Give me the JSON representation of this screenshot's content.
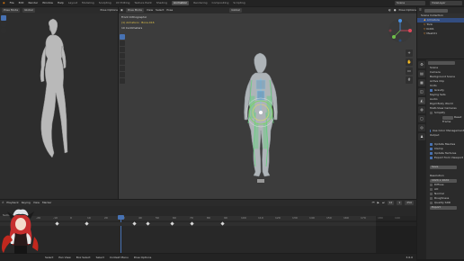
{
  "menu": {
    "items": [
      "File",
      "Edit",
      "Render",
      "Window",
      "Help"
    ],
    "workspaces": [
      "Layout",
      "Modeling",
      "Sculpting",
      "UV Editing",
      "Texture Paint",
      "Shading",
      "Animation",
      "Rendering",
      "Compositing",
      "Scripting"
    ],
    "active_workspace": "Animation",
    "scene": "Scene",
    "view_layer": "ViewLayer"
  },
  "left_view": {
    "mode": "Pose Mode",
    "orientation": "Global",
    "title": "Pose Options"
  },
  "main_view": {
    "mode": "Pose Mode",
    "menus": [
      "View",
      "Select",
      "Pose"
    ],
    "orientation": "Global",
    "options": "Pose Options",
    "ortho_label": "Front Orthographic",
    "object_label": "(1) Armature : Bone.016",
    "units_label": "10 Centimeters"
  },
  "outliner": {
    "header": "Scene Collection",
    "items": [
      "Armature",
      "Tonk",
      "Kid01",
      "Mesh01"
    ]
  },
  "properties": {
    "section_scene": "Scene",
    "camera_label": "Camera",
    "background_label": "Background Scene",
    "active_clip_label": "Active Clip",
    "section_units": "Units",
    "section_gravity": "Gravity",
    "section_keying": "Keying Sets",
    "section_audio": "Audio",
    "section_rigid": "Rigid Body World",
    "section_multiview": "Multi-View Cameras",
    "section_simplify": "Simplify",
    "frame_label": "Frame",
    "reset_label": "Reset",
    "opt_use_color": "Use Color Management",
    "section_io": "Output",
    "opt_mesh": "Update Meshes",
    "opt_curves": "Clamp",
    "opt_textures": "Update Textures",
    "opt_export": "Export from Viewport",
    "save_label": "Save",
    "resolution_label": "Resolution",
    "resolution_value": "1024 x 1024",
    "opt_diffuse": "Diffuse",
    "opt_ao": "AO",
    "opt_normal": "Normal",
    "opt_roughness": "Roughness",
    "opt_bsdf": "Quality SDR",
    "export_label": "Export"
  },
  "timeline": {
    "menus": [
      "Playback",
      "Keying",
      "View",
      "Marker"
    ],
    "current_frame": "12",
    "frame_start": "1",
    "frame_end": "250",
    "ticks": [
      "-20",
      "-10",
      "0",
      "10",
      "20",
      "30",
      "40",
      "50",
      "60",
      "70",
      "80",
      "90",
      "100",
      "110",
      "120",
      "130",
      "140",
      "150",
      "160",
      "170",
      "180",
      "190"
    ],
    "summary_label": "Summary"
  },
  "status": {
    "items": [
      "Select",
      "Pan View",
      "Box Select",
      "Select",
      "Context Menu",
      "Pose Options"
    ],
    "version": "3.6.0"
  },
  "accent": "#4772b3"
}
